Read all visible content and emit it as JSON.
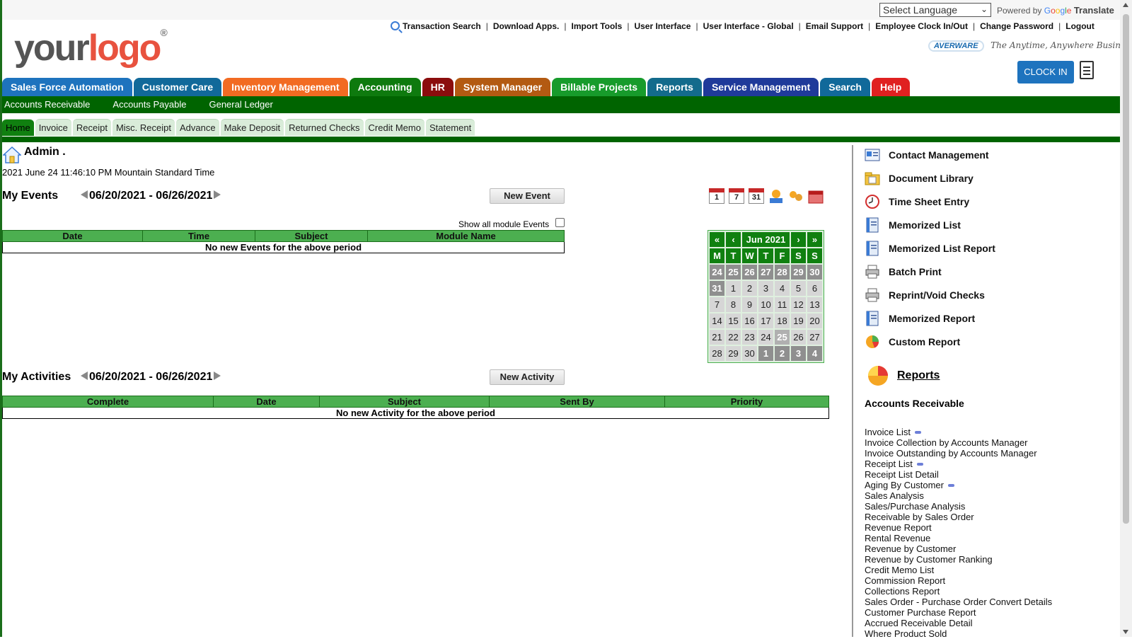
{
  "language": {
    "placeholder": "Select Language",
    "powered_by": "Powered by",
    "google": [
      "G",
      "o",
      "o",
      "g",
      "l",
      "e"
    ],
    "translate": "Translate"
  },
  "top_links": [
    "Transaction Search",
    "Download Apps.",
    "Import Tools",
    "User Interface",
    "User Interface - Global",
    "Email Support",
    "Employee Clock In/Out",
    "Change Password",
    "Logout"
  ],
  "logo": {
    "your": "your",
    "logo": "logo",
    "reg": "®"
  },
  "brand": {
    "name": "AVERWARE",
    "tagline": "The Anytime, Anywhere Business Solution"
  },
  "clock_in": "CLOCK IN",
  "main_tabs": [
    {
      "label": "Sales Force Automation",
      "color": "#1e73be"
    },
    {
      "label": "Customer Care",
      "color": "#11699a"
    },
    {
      "label": "Inventory Management",
      "color": "#f26b22"
    },
    {
      "label": "Accounting",
      "color": "#0e7a0e"
    },
    {
      "label": "HR",
      "color": "#8b0d0d"
    },
    {
      "label": "System Manager",
      "color": "#b35a12"
    },
    {
      "label": "Billable Projects",
      "color": "#179b2b"
    },
    {
      "label": "Reports",
      "color": "#136b8c"
    },
    {
      "label": "Service Management",
      "color": "#1f3a9a"
    },
    {
      "label": "Search",
      "color": "#11699a"
    },
    {
      "label": "Help",
      "color": "#e02020"
    }
  ],
  "sub_nav": [
    "Accounts Receivable",
    "Accounts Payable",
    "General Ledger"
  ],
  "sub_tabs": [
    "Home",
    "Invoice",
    "Receipt",
    "Misc. Receipt",
    "Advance",
    "Make Deposit",
    "Returned Checks",
    "Credit Memo",
    "Statement"
  ],
  "user": {
    "name": "Admin .",
    "datetime": "2021 June 24 11:46:10 PM Mountain Standard Time"
  },
  "events": {
    "title": "My Events",
    "range": "06/20/2021 - 06/26/2021",
    "new_button": "New Event",
    "show_all": "Show all module Events",
    "columns": [
      "Date",
      "Time",
      "Subject",
      "Module Name"
    ],
    "empty": "No new Events for the above period"
  },
  "activities": {
    "title": "My Activities",
    "range": "06/20/2021 - 06/26/2021",
    "new_button": "New Activity",
    "columns": [
      "Complete",
      "Date",
      "Subject",
      "Sent By",
      "Priority"
    ],
    "empty": "No new Activity for the above period"
  },
  "cal_icons": {
    "day": "1",
    "week": "7",
    "month": "31"
  },
  "mini_calendar": {
    "nav": [
      "«",
      "‹",
      "Jun 2021",
      "›",
      "»"
    ],
    "weekdays": [
      "M",
      "T",
      "W",
      "T",
      "F",
      "S",
      "S"
    ],
    "weeks": [
      [
        "24",
        "25",
        "26",
        "27",
        "28",
        "29",
        "30"
      ],
      [
        "31",
        "1",
        "2",
        "3",
        "4",
        "5",
        "6"
      ],
      [
        "7",
        "8",
        "9",
        "10",
        "11",
        "12",
        "13"
      ],
      [
        "14",
        "15",
        "16",
        "17",
        "18",
        "19",
        "20"
      ],
      [
        "21",
        "22",
        "23",
        "24",
        "25",
        "26",
        "27"
      ],
      [
        "28",
        "29",
        "30",
        "1",
        "2",
        "3",
        "4"
      ]
    ]
  },
  "quick_links": [
    "Contact Management",
    "Document Library",
    "Time Sheet Entry",
    "Memorized List",
    "Memorized List Report",
    "Batch Print",
    "Reprint/Void Checks",
    "Memorized Report",
    "Custom Report"
  ],
  "reports": {
    "title": "Reports",
    "section": "Accounts Receivable",
    "items": [
      {
        "label": "Invoice List",
        "dot": true
      },
      {
        "label": "Invoice Collection by Accounts Manager",
        "dot": false
      },
      {
        "label": "Invoice Outstanding by Accounts Manager",
        "dot": false
      },
      {
        "label": "Receipt List",
        "dot": true
      },
      {
        "label": "Receipt List Detail",
        "dot": false
      },
      {
        "label": "Aging By Customer",
        "dot": true
      },
      {
        "label": "Sales Analysis",
        "dot": false
      },
      {
        "label": "Sales/Purchase Analysis",
        "dot": false
      },
      {
        "label": "Receivable by Sales Order",
        "dot": false
      },
      {
        "label": "Revenue Report",
        "dot": false
      },
      {
        "label": "Rental Revenue",
        "dot": false
      },
      {
        "label": "Revenue by Customer",
        "dot": false
      },
      {
        "label": "Revenue by Customer Ranking",
        "dot": false
      },
      {
        "label": "Credit Memo List",
        "dot": false
      },
      {
        "label": "Commission Report",
        "dot": false
      },
      {
        "label": "Collections Report",
        "dot": false
      },
      {
        "label": "Sales Order - Purchase Order Convert Details",
        "dot": false
      },
      {
        "label": "Customer Purchase Report",
        "dot": false
      },
      {
        "label": "Accrued Receivable Detail",
        "dot": false
      },
      {
        "label": "Where Product Sold",
        "dot": false
      }
    ]
  }
}
